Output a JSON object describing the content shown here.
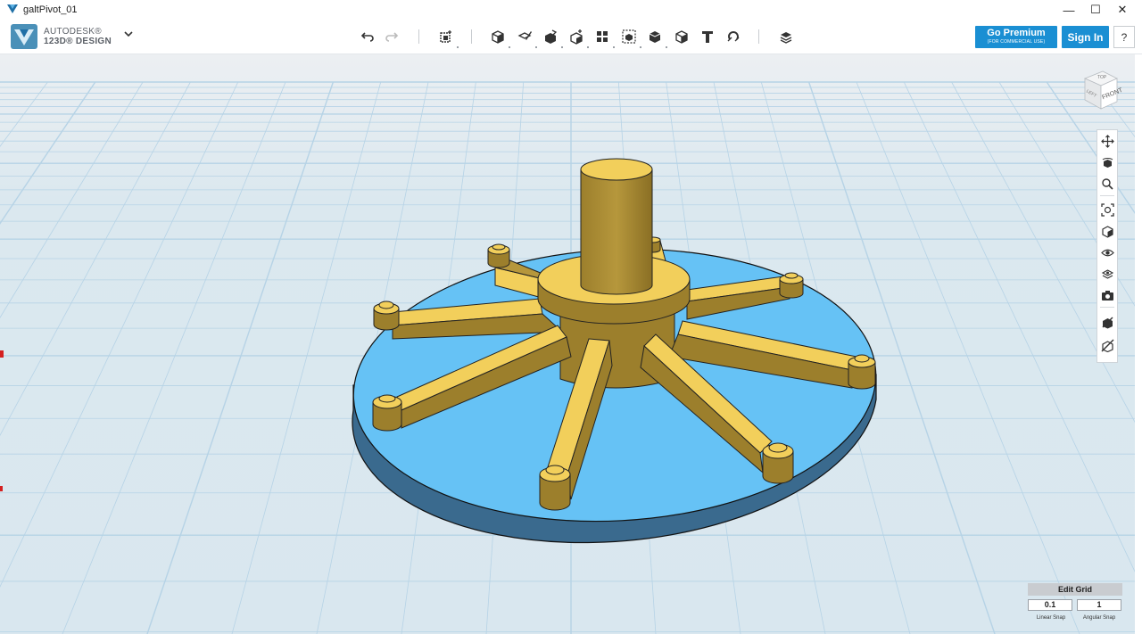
{
  "window": {
    "title": "galtPivot_01",
    "controls": {
      "minimize": "—",
      "maximize": "☐",
      "close": "✕"
    }
  },
  "brand": {
    "line1": "AUTODESK®",
    "line2": "123D® DESIGN"
  },
  "toolbar": {
    "tools": [
      {
        "name": "undo-button",
        "icon": "undo-icon"
      },
      {
        "name": "redo-button",
        "icon": "redo-icon"
      },
      {
        "name": "transform-button",
        "icon": "transform-icon"
      },
      {
        "name": "primitives-button",
        "icon": "primitives-icon"
      },
      {
        "name": "sketch-button",
        "icon": "sketch-icon"
      },
      {
        "name": "construct-button",
        "icon": "construct-icon"
      },
      {
        "name": "modify-button",
        "icon": "modify-icon"
      },
      {
        "name": "pattern-button",
        "icon": "pattern-icon"
      },
      {
        "name": "grouping-button",
        "icon": "grouping-icon"
      },
      {
        "name": "combine-button",
        "icon": "combine-icon"
      },
      {
        "name": "measure-button",
        "icon": "measure-icon"
      },
      {
        "name": "text-button",
        "icon": "text-icon"
      },
      {
        "name": "snap-button",
        "icon": "snap-icon"
      },
      {
        "name": "material-button",
        "icon": "material-icon"
      }
    ],
    "premium_label": "Go Premium",
    "premium_sub": "(FOR COMMERCIAL USE)",
    "signin_label": "Sign In",
    "help_label": "?"
  },
  "viewcube": {
    "front_label": "FRONT",
    "left_label": "LEFT",
    "top_label": "TOP"
  },
  "navbar": {
    "items": [
      "pan-icon",
      "orbit-icon",
      "zoom-icon",
      "fit-icon",
      "view-icon",
      "visibility-icon",
      "materials-icon",
      "camera-icon",
      "outline-icon",
      "hide-icon"
    ]
  },
  "grid_panel": {
    "edit_label": "Edit Grid",
    "linear_value": "0.1",
    "angular_value": "1",
    "linear_label": "Linear Snap",
    "angular_label": "Angular Snap"
  },
  "colors": {
    "accent": "#1a8fd3",
    "grid_bg": "#dfe9ef",
    "grid_line": "#b6d3e6",
    "disc_top": "#66c2f5",
    "disc_side": "#3a6a8e",
    "gold_top": "#f2cf5b",
    "gold_side": "#a88a35"
  }
}
